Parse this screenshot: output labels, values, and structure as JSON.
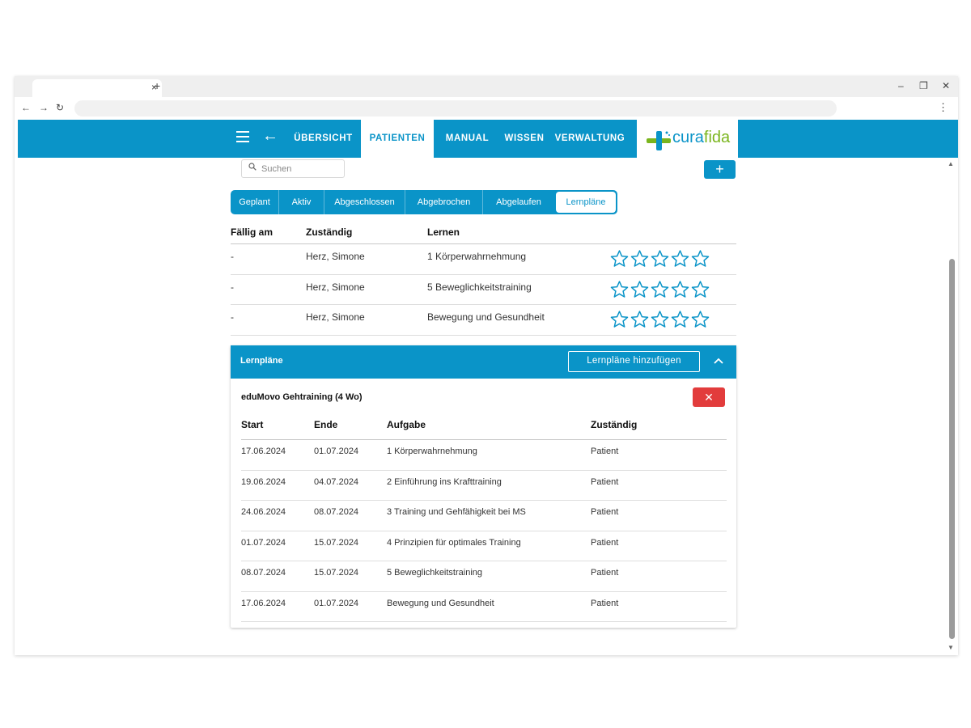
{
  "browser": {
    "tab_close": "×",
    "new_tab": "+",
    "back": "←",
    "forward": "→",
    "reload": "↻",
    "menu": "⋮",
    "minimize": "–",
    "maximize": "❐",
    "close": "✕"
  },
  "header": {
    "back_glyph": "←",
    "nav": [
      "ÜBERSICHT",
      "PATIENTEN",
      "MANUAL",
      "WISSEN",
      "VERWALTUNG"
    ],
    "active_nav": "PATIENTEN",
    "logo_cura": "cura",
    "logo_fida": "fida"
  },
  "search": {
    "placeholder": "Suchen",
    "value": ""
  },
  "add_button": "+",
  "status_tabs": [
    "Geplant",
    "Aktiv",
    "Abgeschlossen",
    "Abgebrochen",
    "Abgelaufen",
    "Lernpläne"
  ],
  "active_status_tab": "Lernpläne",
  "overview_table": {
    "headers": [
      "Fällig am",
      "Zuständig",
      "Lernen"
    ],
    "rows": [
      {
        "due": "-",
        "responsible": "Herz, Simone",
        "lesson": "1 Körperwahrnehmung",
        "rating": 0
      },
      {
        "due": "-",
        "responsible": "Herz, Simone",
        "lesson": "5 Beweglichkeitstraining",
        "rating": 0
      },
      {
        "due": "-",
        "responsible": "Herz, Simone",
        "lesson": "Bewegung und Gesundheit",
        "rating": 0
      }
    ]
  },
  "lernplaene": {
    "title": "Lernpläne",
    "add_label": "Lernpläne hinzufügen",
    "plan_name": "eduMovo Gehtraining (4 Wo)",
    "delete_glyph": "✕",
    "headers": [
      "Start",
      "Ende",
      "Aufgabe",
      "Zuständig"
    ],
    "rows": [
      {
        "start": "17.06.2024",
        "end": "01.07.2024",
        "task": "1 Körperwahrnehmung",
        "responsible": "Patient"
      },
      {
        "start": "19.06.2024",
        "end": "04.07.2024",
        "task": "2 Einführung ins Krafttraining",
        "responsible": "Patient"
      },
      {
        "start": "24.06.2024",
        "end": "08.07.2024",
        "task": "3 Training und Gehfähigkeit bei MS",
        "responsible": "Patient"
      },
      {
        "start": "01.07.2024",
        "end": "15.07.2024",
        "task": "4 Prinzipien für optimales Training",
        "responsible": "Patient"
      },
      {
        "start": "08.07.2024",
        "end": "15.07.2024",
        "task": "5 Beweglichkeitstraining",
        "responsible": "Patient"
      },
      {
        "start": "17.06.2024",
        "end": "01.07.2024",
        "task": "Bewegung und Gesundheit",
        "responsible": "Patient"
      }
    ]
  },
  "colors": {
    "primary": "#0a94c8",
    "logo_green": "#7ab51d",
    "danger": "#e23c3c"
  }
}
